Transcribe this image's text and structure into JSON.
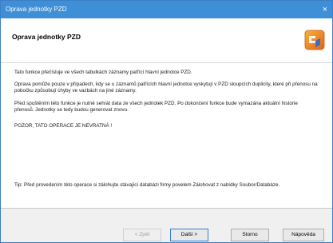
{
  "window": {
    "title": "Oprava jednotky PZD",
    "close_glyph": "×"
  },
  "header": {
    "title": "Oprava jednotky PZD",
    "logo_icon": "wizard-logo-icon"
  },
  "content": {
    "para1": "Tato funkce přečísluje ve všech tabulkách záznamy patřící hlavní jednotce PZD.",
    "para2": "Oprava pomůže pouze v případech, kdy se u záznamů patřících hlavní jednotce vyskytují v PZD sloupcích duplicity, které při přenosu na pobočku způsobují chyby ve vazbách na jiné záznamy.",
    "para3": "Před spuštěním této funkce je nutné sehrát data ze všech jednotek PZD. Po dokončení funkce bude vymazána aktuální historie přenosů. Jednotky se tedy budou generovat znovu.",
    "warning": "POZOR, TATO OPERACE JE NEVRATNÁ !",
    "tip": "Tip: Před provedením této operace si zálohujte stávající databázi firmy povelem Zálohovat z nabídky Soubor/Databáze."
  },
  "buttons": {
    "back": "< Zpět",
    "next": "Další >",
    "cancel": "Storno",
    "help": "Nápověda"
  }
}
